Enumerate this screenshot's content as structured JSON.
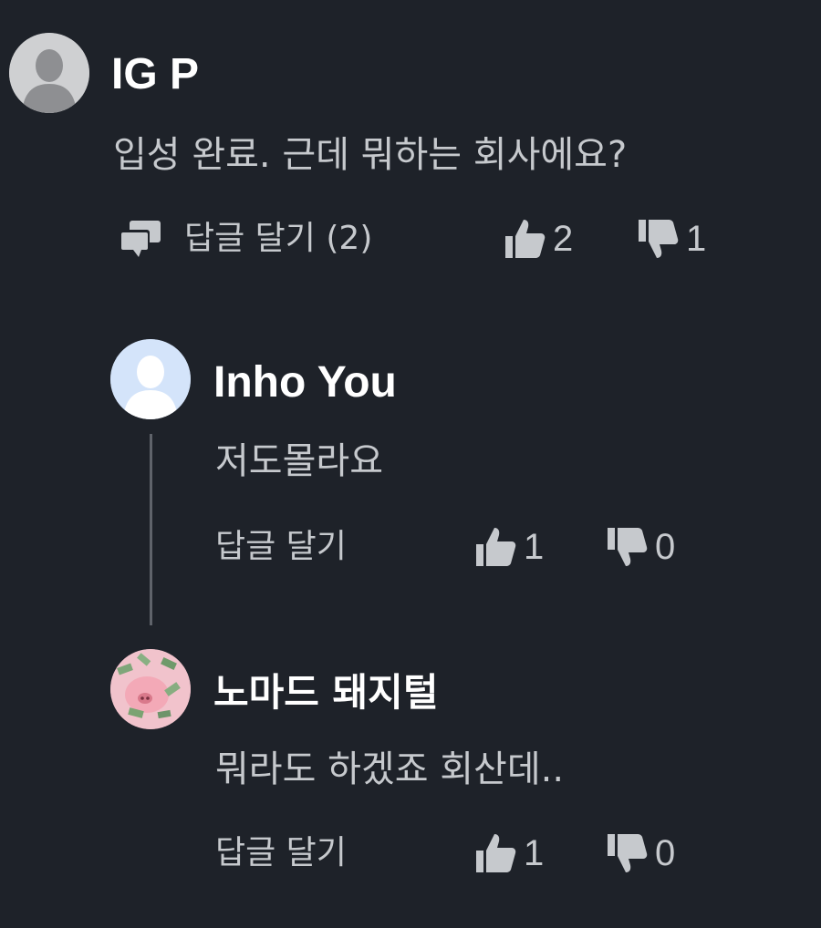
{
  "comments": [
    {
      "author": "IG P",
      "text": "입성 완료. 근데 뭐하는 회사에요?",
      "reply_label": "답글 달기 (2)",
      "likes": "2",
      "dislikes": "1"
    },
    {
      "author": "Inho You",
      "text": "저도몰라요",
      "reply_label": "답글 달기",
      "likes": "1",
      "dislikes": "0"
    },
    {
      "author": "노마드 돼지털",
      "text": "뭐라도 하겠죠 회산데..",
      "reply_label": "답글 달기",
      "likes": "1",
      "dislikes": "0"
    }
  ],
  "colors": {
    "background": "#1e2229",
    "author": "#ffffff",
    "body_text": "#c6c9cd",
    "thread_line": "#5f636a",
    "avatar_gray": "#cfd0d2",
    "avatar_blue": "#d4e4fa",
    "avatar_pink": "#f1c3cc"
  }
}
